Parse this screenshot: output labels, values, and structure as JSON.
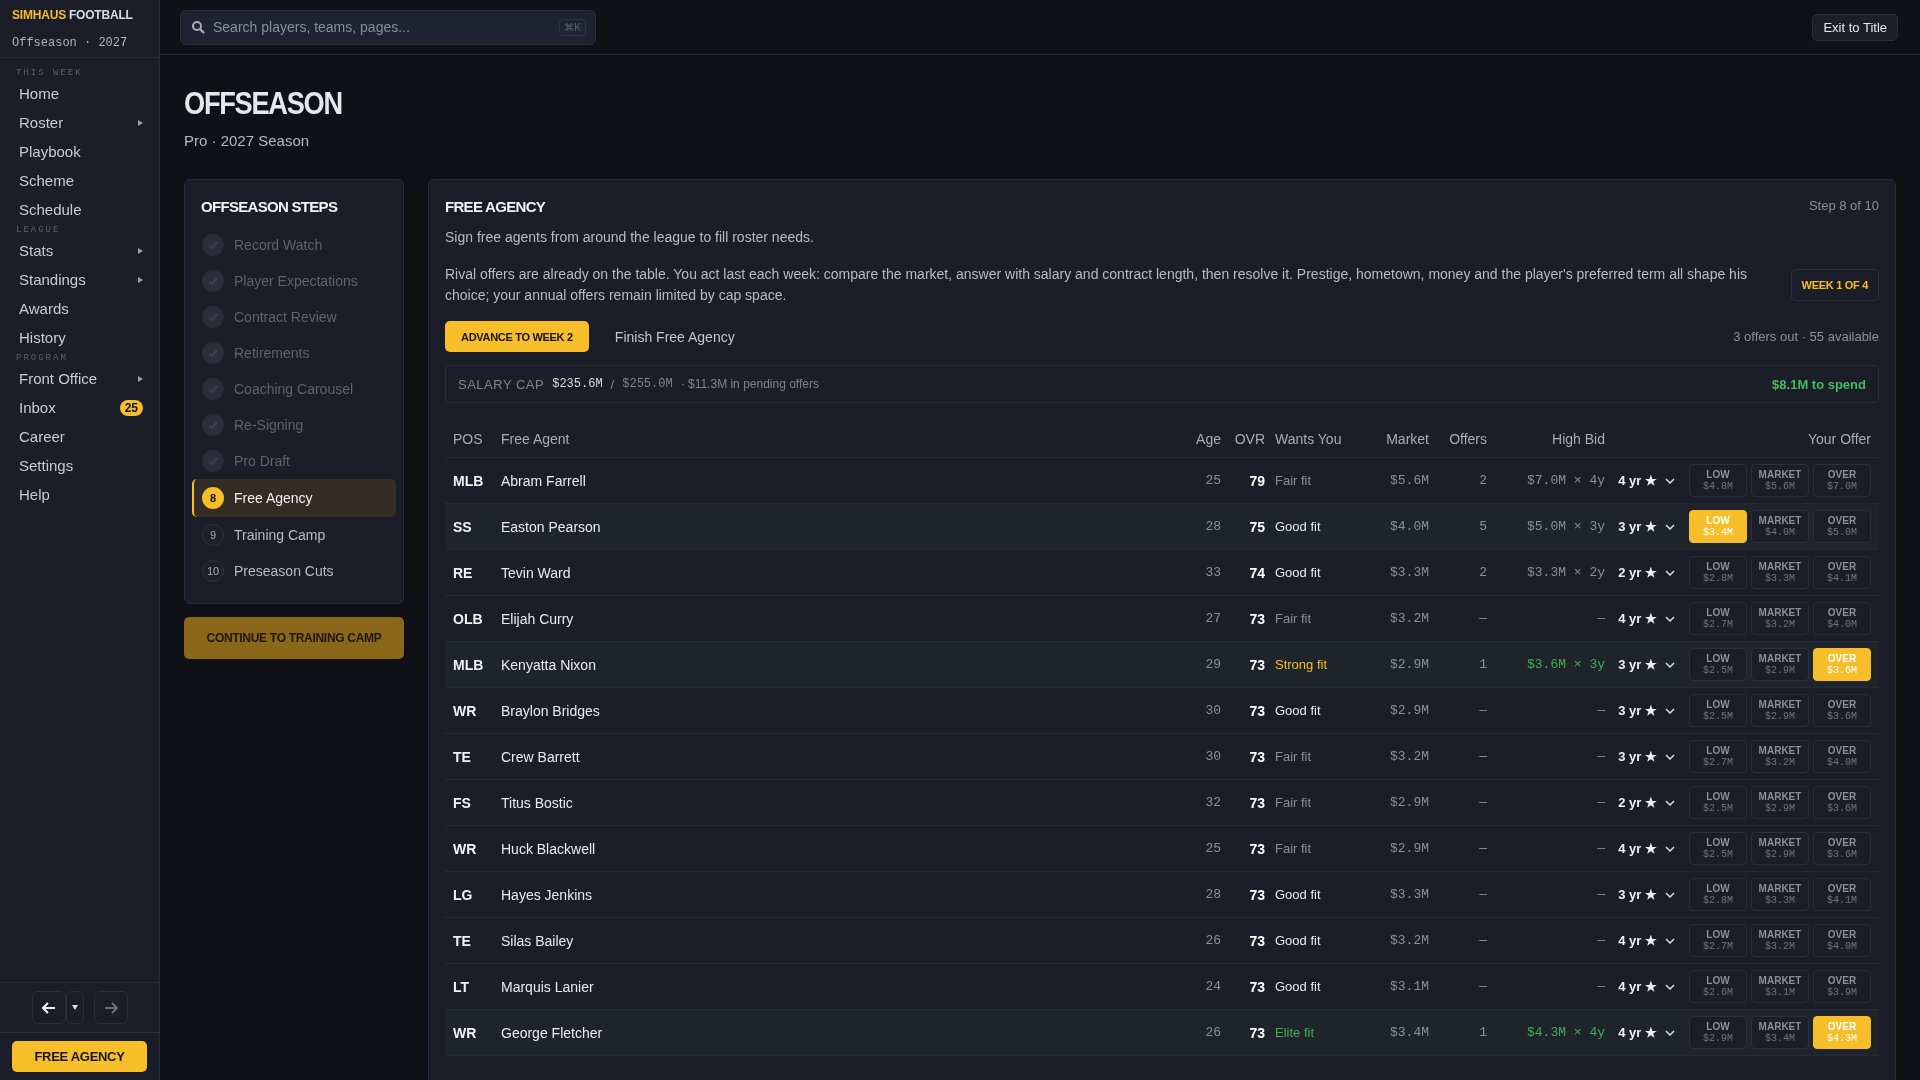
{
  "sidebar": {
    "brand": {
      "highlight": "SIMHAUS",
      "rest": "FOOTBALL"
    },
    "subtitle": "Offseason · 2027",
    "sections": [
      {
        "label": "THIS WEEK",
        "items": [
          {
            "label": "Home",
            "has_submenu": false
          },
          {
            "label": "Roster",
            "has_submenu": true
          },
          {
            "label": "Playbook",
            "has_submenu": false
          },
          {
            "label": "Scheme",
            "has_submenu": false
          },
          {
            "label": "Schedule",
            "has_submenu": false
          }
        ]
      },
      {
        "label": "LEAGUE",
        "items": [
          {
            "label": "Stats",
            "has_submenu": true
          },
          {
            "label": "Standings",
            "has_submenu": true
          },
          {
            "label": "Awards",
            "has_submenu": false
          },
          {
            "label": "History",
            "has_submenu": false
          }
        ]
      },
      {
        "label": "PROGRAM",
        "items": [
          {
            "label": "Front Office",
            "has_submenu": true
          },
          {
            "label": "Inbox",
            "has_submenu": false,
            "badge": "25"
          },
          {
            "label": "Career",
            "has_submenu": false
          },
          {
            "label": "Settings",
            "has_submenu": false
          },
          {
            "label": "Help",
            "has_submenu": false
          }
        ]
      }
    ],
    "history_nav": {
      "back_disabled": false,
      "forward_disabled": true
    },
    "current_button": "FREE AGENCY"
  },
  "topbar": {
    "search": {
      "placeholder": "Search players, teams, pages...",
      "shortcut": "⌘K"
    },
    "exit_button": "Exit to Title"
  },
  "page": {
    "title": "OFFSEASON",
    "subtitle": "Pro · 2027 Season"
  },
  "steps": {
    "title": "OFFSEASON STEPS",
    "items": [
      {
        "label": "Record Watch",
        "kind": "done"
      },
      {
        "label": "Player Expectations",
        "kind": "done"
      },
      {
        "label": "Contract Review",
        "kind": "done"
      },
      {
        "label": "Retirements",
        "kind": "done"
      },
      {
        "label": "Coaching Carousel",
        "kind": "done"
      },
      {
        "label": "Re-Signing",
        "kind": "done"
      },
      {
        "label": "Pro Draft",
        "kind": "done"
      },
      {
        "number": "8",
        "label": "Free Agency",
        "kind": "current"
      },
      {
        "number": "9",
        "label": "Training Camp",
        "kind": "upcoming"
      },
      {
        "number": "10",
        "label": "Preseason Cuts",
        "kind": "upcoming"
      }
    ],
    "continue_button": "CONTINUE TO TRAINING CAMP"
  },
  "free_agency": {
    "title": "FREE AGENCY",
    "step": "Step 8 of 10",
    "intro": "Sign free agents from around the league to fill roster needs.",
    "details": "Rival offers are already on the table. You act last each week: compare the market, answer with salary and contract length, then resolve it. Prestige, hometown, money and the player's preferred term all shape his choice; your annual offers remain limited by cap space.",
    "week_badge": "WEEK 1 OF 4",
    "advance_button": "ADVANCE TO WEEK 2",
    "finish_link": "Finish Free Agency",
    "summary": "3 offers out · 55 available",
    "salary_cap": {
      "label": "SALARY CAP",
      "used": "$235.6M",
      "separator": "/",
      "total": "$255.0M",
      "pending": "· $11.3M in pending offers",
      "remaining": "$8.1M to spend"
    },
    "table": {
      "columns": [
        "POS",
        "Free Agent",
        "Age",
        "OVR",
        "Wants You",
        "Market",
        "Offers",
        "High Bid",
        "Your Offer"
      ],
      "rows": [
        {
          "pos": "MLB",
          "name": "Abram Farrell",
          "age": "25",
          "ovr": "79",
          "wants": {
            "text": "Fair fit",
            "kind": "fair"
          },
          "market": "$5.6M",
          "offers": "2",
          "high_bid": "$7.0M × 4y",
          "bid_leading": false,
          "term": "4 yr ★",
          "options": [
            {
              "label": "LOW",
              "amount": "$4.8M",
              "selected": false
            },
            {
              "label": "MARKET",
              "amount": "$5.6M",
              "selected": false
            },
            {
              "label": "OVER",
              "amount": "$7.0M",
              "selected": false
            }
          ]
        },
        {
          "pos": "SS",
          "name": "Easton Pearson",
          "age": "28",
          "ovr": "75",
          "wants": {
            "text": "Good fit",
            "kind": "good"
          },
          "market": "$4.0M",
          "offers": "5",
          "high_bid": "$5.0M × 3y",
          "bid_leading": false,
          "term": "3 yr ★",
          "options": [
            {
              "label": "LOW",
              "amount": "$3.4M",
              "selected": true
            },
            {
              "label": "MARKET",
              "amount": "$4.0M",
              "selected": false
            },
            {
              "label": "OVER",
              "amount": "$5.0M",
              "selected": false
            }
          ]
        },
        {
          "pos": "RE",
          "name": "Tevin Ward",
          "age": "33",
          "ovr": "74",
          "wants": {
            "text": "Good fit",
            "kind": "good"
          },
          "market": "$3.3M",
          "offers": "2",
          "high_bid": "$3.3M × 2y",
          "bid_leading": false,
          "term": "2 yr ★",
          "options": [
            {
              "label": "LOW",
              "amount": "$2.8M",
              "selected": false
            },
            {
              "label": "MARKET",
              "amount": "$3.3M",
              "selected": false
            },
            {
              "label": "OVER",
              "amount": "$4.1M",
              "selected": false
            }
          ]
        },
        {
          "pos": "OLB",
          "name": "Elijah Curry",
          "age": "27",
          "ovr": "73",
          "wants": {
            "text": "Fair fit",
            "kind": "fair"
          },
          "market": "$3.2M",
          "offers": "—",
          "high_bid": "—",
          "bid_leading": false,
          "term": "4 yr ★",
          "options": [
            {
              "label": "LOW",
              "amount": "$2.7M",
              "selected": false
            },
            {
              "label": "MARKET",
              "amount": "$3.2M",
              "selected": false
            },
            {
              "label": "OVER",
              "amount": "$4.0M",
              "selected": false
            }
          ]
        },
        {
          "pos": "MLB",
          "name": "Kenyatta Nixon",
          "age": "29",
          "ovr": "73",
          "wants": {
            "text": "Strong fit",
            "kind": "strong"
          },
          "market": "$2.9M",
          "offers": "1",
          "high_bid": "$3.6M × 3y",
          "bid_leading": true,
          "term": "3 yr ★",
          "options": [
            {
              "label": "LOW",
              "amount": "$2.5M",
              "selected": false
            },
            {
              "label": "MARKET",
              "amount": "$2.9M",
              "selected": false
            },
            {
              "label": "OVER",
              "amount": "$3.6M",
              "selected": true
            }
          ]
        },
        {
          "pos": "WR",
          "name": "Braylon Bridges",
          "age": "30",
          "ovr": "73",
          "wants": {
            "text": "Good fit",
            "kind": "good"
          },
          "market": "$2.9M",
          "offers": "—",
          "high_bid": "—",
          "bid_leading": false,
          "term": "3 yr ★",
          "options": [
            {
              "label": "LOW",
              "amount": "$2.5M",
              "selected": false
            },
            {
              "label": "MARKET",
              "amount": "$2.9M",
              "selected": false
            },
            {
              "label": "OVER",
              "amount": "$3.6M",
              "selected": false
            }
          ]
        },
        {
          "pos": "TE",
          "name": "Crew Barrett",
          "age": "30",
          "ovr": "73",
          "wants": {
            "text": "Fair fit",
            "kind": "fair"
          },
          "market": "$3.2M",
          "offers": "—",
          "high_bid": "—",
          "bid_leading": false,
          "term": "3 yr ★",
          "options": [
            {
              "label": "LOW",
              "amount": "$2.7M",
              "selected": false
            },
            {
              "label": "MARKET",
              "amount": "$3.2M",
              "selected": false
            },
            {
              "label": "OVER",
              "amount": "$4.0M",
              "selected": false
            }
          ]
        },
        {
          "pos": "FS",
          "name": "Titus Bostic",
          "age": "32",
          "ovr": "73",
          "wants": {
            "text": "Fair fit",
            "kind": "fair"
          },
          "market": "$2.9M",
          "offers": "—",
          "high_bid": "—",
          "bid_leading": false,
          "term": "2 yr ★",
          "options": [
            {
              "label": "LOW",
              "amount": "$2.5M",
              "selected": false
            },
            {
              "label": "MARKET",
              "amount": "$2.9M",
              "selected": false
            },
            {
              "label": "OVER",
              "amount": "$3.6M",
              "selected": false
            }
          ]
        },
        {
          "pos": "WR",
          "name": "Huck Blackwell",
          "age": "25",
          "ovr": "73",
          "wants": {
            "text": "Fair fit",
            "kind": "fair"
          },
          "market": "$2.9M",
          "offers": "—",
          "high_bid": "—",
          "bid_leading": false,
          "term": "4 yr ★",
          "options": [
            {
              "label": "LOW",
              "amount": "$2.5M",
              "selected": false
            },
            {
              "label": "MARKET",
              "amount": "$2.9M",
              "selected": false
            },
            {
              "label": "OVER",
              "amount": "$3.6M",
              "selected": false
            }
          ]
        },
        {
          "pos": "LG",
          "name": "Hayes Jenkins",
          "age": "28",
          "ovr": "73",
          "wants": {
            "text": "Good fit",
            "kind": "good"
          },
          "market": "$3.3M",
          "offers": "—",
          "high_bid": "—",
          "bid_leading": false,
          "term": "3 yr ★",
          "options": [
            {
              "label": "LOW",
              "amount": "$2.8M",
              "selected": false
            },
            {
              "label": "MARKET",
              "amount": "$3.3M",
              "selected": false
            },
            {
              "label": "OVER",
              "amount": "$4.1M",
              "selected": false
            }
          ]
        },
        {
          "pos": "TE",
          "name": "Silas Bailey",
          "age": "26",
          "ovr": "73",
          "wants": {
            "text": "Good fit",
            "kind": "good"
          },
          "market": "$3.2M",
          "offers": "—",
          "high_bid": "—",
          "bid_leading": false,
          "term": "4 yr ★",
          "options": [
            {
              "label": "LOW",
              "amount": "$2.7M",
              "selected": false
            },
            {
              "label": "MARKET",
              "amount": "$3.2M",
              "selected": false
            },
            {
              "label": "OVER",
              "amount": "$4.0M",
              "selected": false
            }
          ]
        },
        {
          "pos": "LT",
          "name": "Marquis Lanier",
          "age": "24",
          "ovr": "73",
          "wants": {
            "text": "Good fit",
            "kind": "good"
          },
          "market": "$3.1M",
          "offers": "—",
          "high_bid": "—",
          "bid_leading": false,
          "term": "4 yr ★",
          "options": [
            {
              "label": "LOW",
              "amount": "$2.6M",
              "selected": false
            },
            {
              "label": "MARKET",
              "amount": "$3.1M",
              "selected": false
            },
            {
              "label": "OVER",
              "amount": "$3.9M",
              "selected": false
            }
          ]
        },
        {
          "pos": "WR",
          "name": "George Fletcher",
          "age": "26",
          "ovr": "73",
          "wants": {
            "text": "Elite fit",
            "kind": "elite"
          },
          "market": "$3.4M",
          "offers": "1",
          "high_bid": "$4.3M × 4y",
          "bid_leading": true,
          "term": "4 yr ★",
          "options": [
            {
              "label": "LOW",
              "amount": "$2.9M",
              "selected": false
            },
            {
              "label": "MARKET",
              "amount": "$3.4M",
              "selected": false
            },
            {
              "label": "OVER",
              "amount": "$4.3M",
              "selected": true
            }
          ]
        }
      ]
    }
  }
}
